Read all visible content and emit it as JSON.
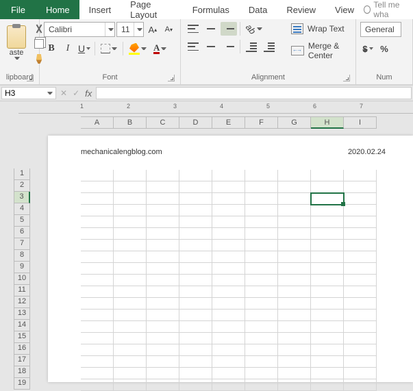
{
  "tabs": {
    "file": "File",
    "home": "Home",
    "insert": "Insert",
    "pageLayout": "Page Layout",
    "formulas": "Formulas",
    "data": "Data",
    "review": "Review",
    "view": "View",
    "tellMe": "Tell me wha"
  },
  "ribbon": {
    "clipboard": {
      "label": "lipboard",
      "paste": "aste"
    },
    "font": {
      "label": "Font",
      "name": "Calibri",
      "size": "11",
      "increaseA": "A",
      "decreaseA": "A",
      "bold": "B",
      "italic": "I",
      "underline": "U",
      "fontColorA": "A"
    },
    "alignment": {
      "label": "Alignment",
      "wrap": "Wrap Text",
      "merge": "Merge & Center"
    },
    "number": {
      "label": "Num",
      "format": "General",
      "dollar": "$",
      "percent": "%"
    }
  },
  "formulaBar": {
    "ref": "H3",
    "cancel": "✕",
    "enter": "✓",
    "fx": "fx"
  },
  "sheet": {
    "headerLeft": "mechanicalengblog.com",
    "headerRight": "2020.02.24",
    "cols": [
      "A",
      "B",
      "C",
      "D",
      "E",
      "F",
      "G",
      "H",
      "I"
    ],
    "rows": [
      "1",
      "2",
      "3",
      "4",
      "5",
      "6",
      "7",
      "8",
      "9",
      "10",
      "11",
      "12",
      "13",
      "14",
      "15",
      "16",
      "17",
      "18",
      "19"
    ],
    "selectedCol": "H",
    "selectedRow": "3",
    "rulerTicks": [
      "1",
      "2",
      "3",
      "4",
      "5",
      "6",
      "7"
    ]
  }
}
